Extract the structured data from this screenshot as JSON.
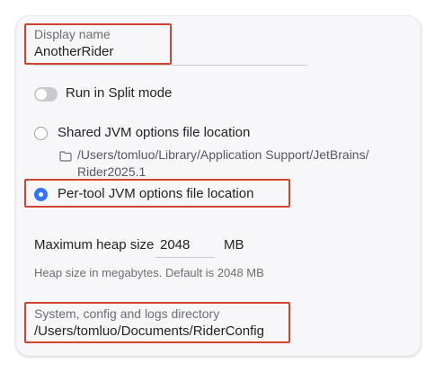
{
  "display_name": {
    "label": "Display name",
    "value": "AnotherRider"
  },
  "split_mode": {
    "label": "Run in Split mode",
    "enabled": false
  },
  "jvm_options": {
    "shared_label": "Shared JVM options file location",
    "shared_path_line1": "/Users/tomluo/Library/Application Support/JetBrains/",
    "shared_path_line2": "Rider2025.1",
    "per_tool_label": "Per-tool JVM options file location",
    "selected": "per_tool"
  },
  "heap": {
    "label": "Maximum heap size",
    "value": "2048",
    "unit": "MB",
    "hint": "Heap size in megabytes. Default is 2048 MB"
  },
  "system_dir": {
    "label": "System, config and logs directory",
    "value": "/Users/tomluo/Documents/RiderConfig"
  },
  "colors": {
    "highlight_border": "#d2442f",
    "accent": "#3574f0"
  }
}
